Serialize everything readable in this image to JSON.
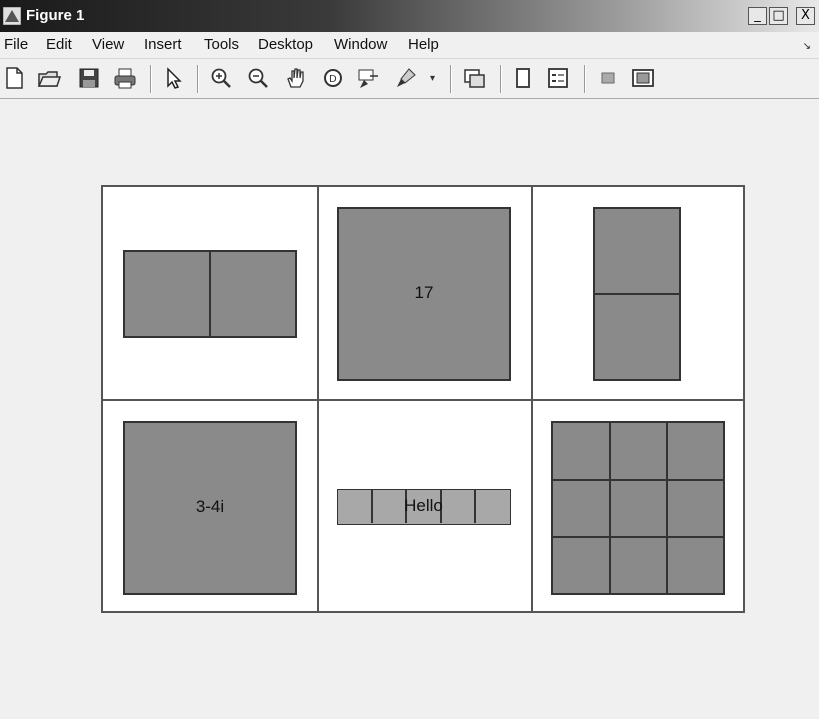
{
  "window": {
    "title": "Figure 1",
    "buttons": [
      "_",
      "□",
      "X"
    ]
  },
  "menu": {
    "items": [
      "File",
      "Edit",
      "View",
      "Insert",
      "Tools",
      "Desktop",
      "Window",
      "Help"
    ]
  },
  "toolbar": {
    "icons": [
      "new-figure-icon",
      "open-file-icon",
      "save-icon",
      "print-icon",
      "pointer-icon",
      "zoom-in-icon",
      "zoom-out-icon",
      "pan-hand-icon",
      "rotate-3d-icon",
      "data-cursor-icon",
      "brush-icon",
      "dropdown-arrow-icon",
      "link-plot-icon",
      "colorbar-icon",
      "legend-icon",
      "hide-plot-tools-icon",
      "show-plot-tools-icon"
    ]
  },
  "cells": {
    "r2c2": {
      "label": "17"
    },
    "r2c1": {
      "label": "3-4i"
    },
    "r2c2b": {
      "label": "Hello"
    }
  },
  "colors": {
    "fill": "#8a8a8a",
    "light_fill": "#a8a8a8",
    "edge": "#333333",
    "background": "#ffffff"
  }
}
